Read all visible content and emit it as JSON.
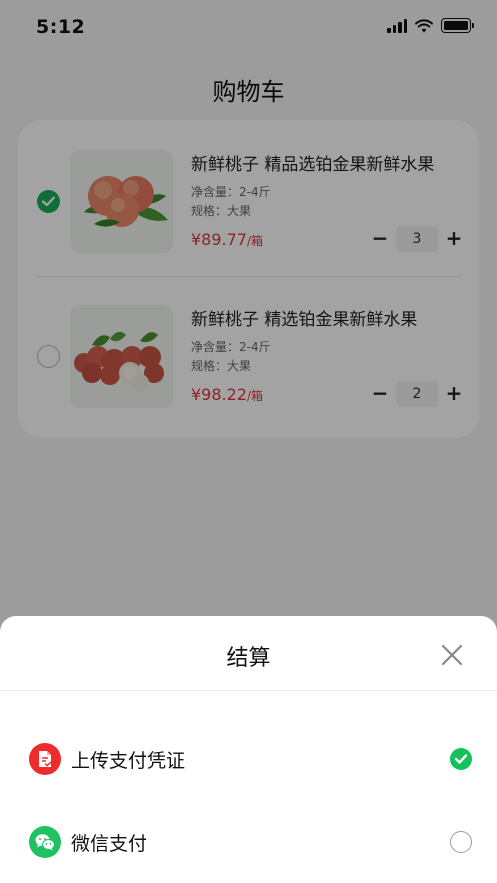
{
  "status_bar": {
    "time": "5:12"
  },
  "page": {
    "title": "购物车"
  },
  "cart": {
    "items": [
      {
        "name": "新鲜桃子 精品选铂金果新鲜水果",
        "net_weight": "净含量：2-4斤",
        "spec": "规格：大果",
        "price": "¥89.77",
        "price_unit": "/箱",
        "quantity": "3",
        "checked": true
      },
      {
        "name": "新鲜桃子 精选铂金果新鲜水果",
        "net_weight": "净含量：2-4斤",
        "spec": "规格：大果",
        "price": "¥98.22",
        "price_unit": "/箱",
        "quantity": "2",
        "checked": false
      }
    ],
    "stepper": {
      "minus": "−",
      "plus": "+"
    }
  },
  "checkout_sheet": {
    "title": "结算",
    "close_icon": "close-icon",
    "options": [
      {
        "label": "上传支付凭证",
        "icon": "upload-voucher-icon",
        "selected": true
      },
      {
        "label": "微信支付",
        "icon": "wechat-icon",
        "selected": false
      }
    ]
  },
  "colors": {
    "price": "#e0383e",
    "checkbox_green": "#1aad5a",
    "radio_green": "#14c15a",
    "voucher_red": "#ef2b2b",
    "wechat_green": "#1fc160"
  }
}
